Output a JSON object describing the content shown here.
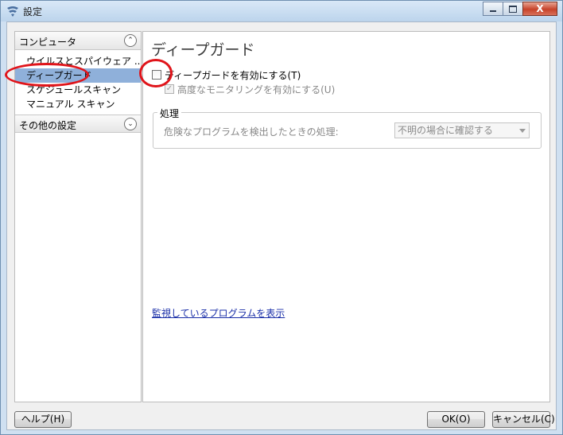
{
  "window": {
    "title": "設定",
    "close_glyph": "X"
  },
  "sidebar": {
    "sections": [
      {
        "label": "コンピュータ",
        "expanded": true,
        "items": [
          {
            "label": "ウイルスとスパイウェア ..."
          },
          {
            "label": "ディープガード",
            "selected": true
          },
          {
            "label": "スケジュールスキャン"
          },
          {
            "label": "マニュアル スキャン"
          }
        ]
      },
      {
        "label": "その他の設定",
        "expanded": false,
        "items": []
      }
    ],
    "chevrons": {
      "up": "⌃",
      "down": "⌄"
    }
  },
  "content": {
    "title": "ディープガード",
    "enable_checkbox": {
      "label": "ディープガードを有効にする(T)",
      "checked": false
    },
    "advanced_checkbox": {
      "label": "高度なモニタリングを有効にする(U)",
      "checked": true,
      "disabled": true,
      "check_glyph": "✓"
    },
    "action_group": {
      "title": "処理",
      "label": "危険なプログラムを検出したときの処理:",
      "select_value": "不明の場合に確認する",
      "disabled": true
    },
    "link_text": "監視しているプログラムを表示"
  },
  "buttons": {
    "help": "ヘルプ(H)",
    "ok": "OK(O)",
    "cancel": "キャンセル(C)"
  },
  "colors": {
    "selection": "#8fb0da",
    "annotation": "#e0141a",
    "link": "#1a2fa8"
  }
}
